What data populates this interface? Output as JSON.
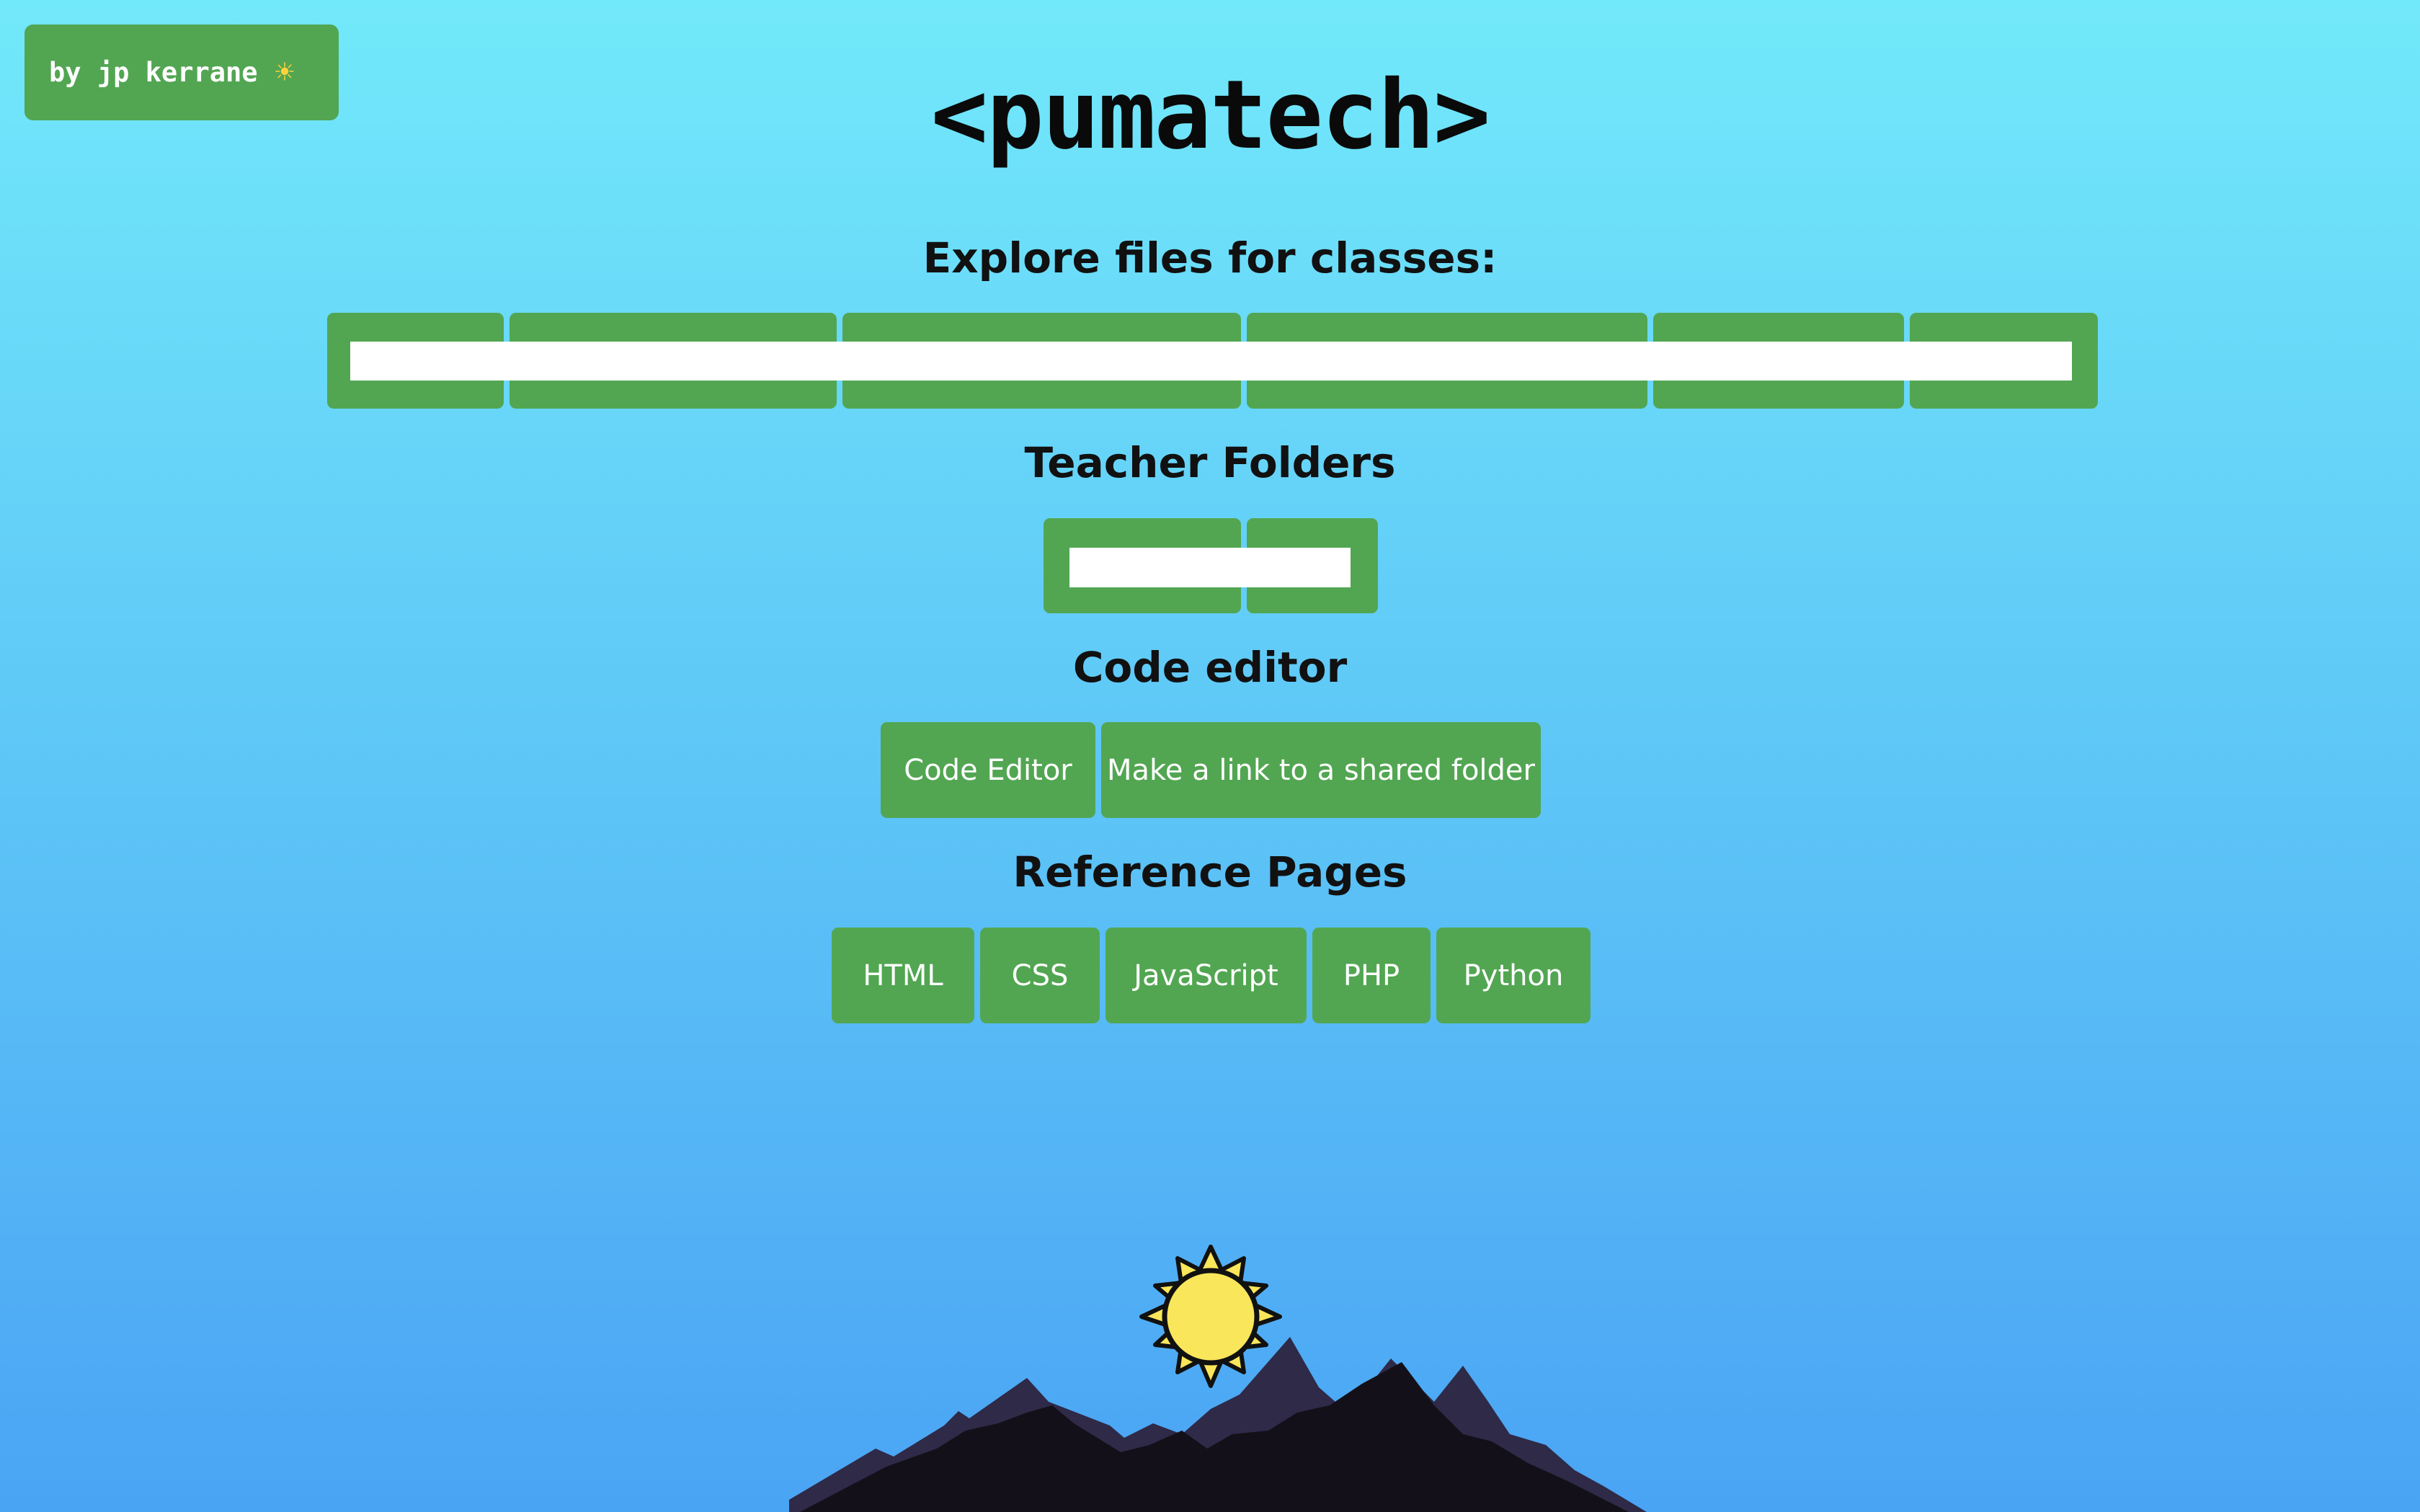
{
  "credit": {
    "label": "by jp kerrane",
    "icon": "sun-icon"
  },
  "title": "<pumatech>",
  "sections": {
    "explore": {
      "heading": "Explore files for classes:",
      "buttons": [
        "",
        "",
        "",
        "",
        "",
        ""
      ]
    },
    "teacher": {
      "heading": "Teacher Folders",
      "buttons": [
        "",
        ""
      ]
    },
    "editor": {
      "heading": "Code editor",
      "buttons": [
        "Code Editor",
        "Make a link to a shared folder"
      ]
    },
    "reference": {
      "heading": "Reference Pages",
      "buttons": [
        "HTML",
        "CSS",
        "JavaScript",
        "PHP",
        "Python"
      ]
    }
  },
  "colors": {
    "button_green": "#52a652",
    "sky_top": "#72e9fa",
    "sky_bottom": "#4aa4f4",
    "sun_yellow": "#f9e65a",
    "mountain_back": "#2e2a48",
    "mountain_front": "#141019"
  },
  "decorations": {
    "sun": "sun-icon",
    "mountains": "mountain-illustration"
  }
}
